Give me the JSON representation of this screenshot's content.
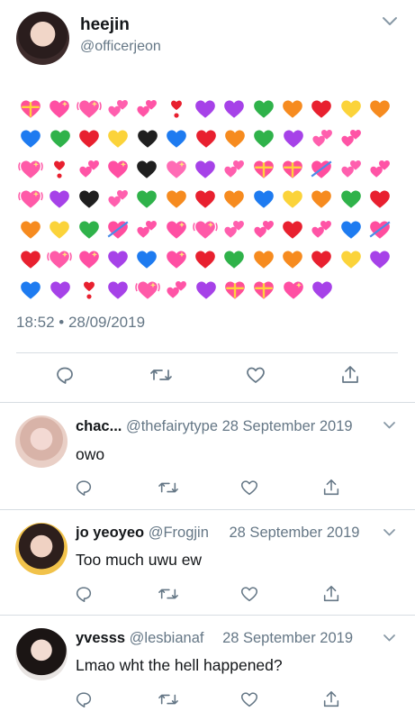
{
  "main_tweet": {
    "name": "heejin",
    "handle": "@officerjeon",
    "timestamp": "18:52 • 28/09/2019",
    "emoji_rows": [
      [
        "💝",
        "💖",
        "💓",
        "💕",
        "💞",
        "❣️",
        "💜",
        "💜",
        "💚",
        "🧡",
        "❤️",
        "💛",
        "🧡"
      ],
      [
        "💙",
        "💚",
        "❤️",
        "💛",
        "🖤",
        "💙",
        "❤️",
        "🧡",
        "💚",
        "💜",
        "💕",
        "💞"
      ],
      [
        "💓",
        "❣️",
        "💞",
        "💖",
        "🖤",
        "💗",
        "💜",
        "💕",
        "💝",
        "💝",
        "💘",
        "💕",
        "💞"
      ],
      [
        "💓",
        "💜",
        "🖤",
        "💕",
        "💚",
        "🧡",
        "❤️",
        "🧡",
        "💙",
        "💛",
        "🧡",
        "💚",
        "❤️"
      ],
      [
        "🧡",
        "💛",
        "💚",
        "💘",
        "💞",
        "💖",
        "💓",
        "💕",
        "💞",
        "❤️",
        "💞",
        "💙",
        "💘"
      ],
      [
        "❤️",
        "💓",
        "💖",
        "💜",
        "💙",
        "💖",
        "❤️",
        "💚",
        "🧡",
        "🧡",
        "❤️",
        "💛",
        "💜"
      ],
      [
        "💙",
        "💜",
        "❣️",
        "💜",
        "💓",
        "💞",
        "💜",
        "💝",
        "💝",
        "💖",
        "💜"
      ]
    ]
  },
  "replies": [
    {
      "name": "chac...",
      "handle": "@thefairytype",
      "date": "28 September 2019",
      "text": "owo"
    },
    {
      "name": "jo yeoyeo",
      "handle": "@Frogjin",
      "date": "28 September 2019",
      "text": "Too much uwu ew"
    },
    {
      "name": "yvesss",
      "handle": "@lesbianaf",
      "date": "28 September 2019",
      "text": "Lmao wht the hell happened?"
    }
  ],
  "icons": {
    "reply": "speech-bubble-icon",
    "retweet": "retweet-icon",
    "like": "heart-outline-icon",
    "share": "share-icon",
    "more": "chevron-down-icon"
  },
  "colors": {
    "text": "#14171a",
    "muted": "#657786",
    "divider": "#d7dde2"
  }
}
